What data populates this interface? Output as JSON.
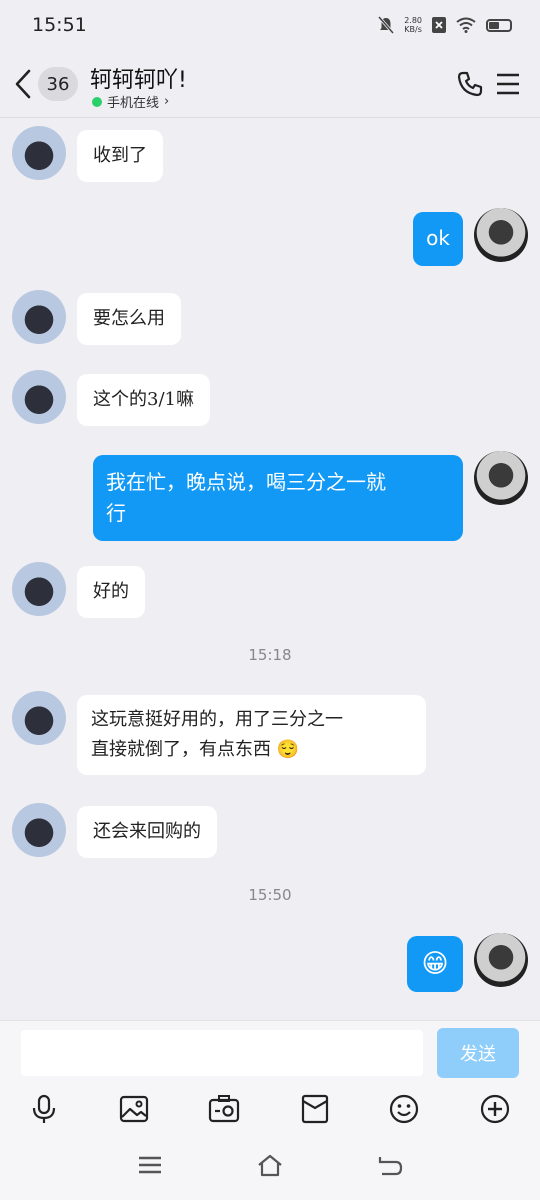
{
  "status_bar": {
    "time": "15:51",
    "net_speed_value": "2.80",
    "net_speed_unit": "KB/s"
  },
  "header": {
    "unread_count": "36",
    "contact_name": "轲轲轲吖!",
    "contact_status": "手机在线",
    "status_chevron": "›"
  },
  "messages": [
    {
      "side": "left",
      "text": "收到了"
    },
    {
      "side": "right",
      "text": "ok"
    },
    {
      "side": "left",
      "text": "要怎么用"
    },
    {
      "side": "left",
      "text": "这个的3/1嘛"
    },
    {
      "side": "right",
      "text_line1": "我在忙，晚点说，喝三分之一就",
      "text_line2": "行"
    },
    {
      "side": "left",
      "text": "好的"
    },
    {
      "side": "time",
      "text": "15:18"
    },
    {
      "side": "left",
      "text_line1": "这玩意挺好用的，用了三分之一",
      "text_line2": "直接就倒了，有点东西",
      "emoji": "😌"
    },
    {
      "side": "left",
      "text": "还会来回购的"
    },
    {
      "side": "time",
      "text": "15:50"
    },
    {
      "side": "right",
      "emoji": "😁"
    }
  ],
  "input": {
    "placeholder": "",
    "value": "",
    "send_label": "发送"
  },
  "toolbar": {
    "icons": [
      "microphone-icon",
      "image-icon",
      "camera-icon",
      "red-packet-icon",
      "emoji-icon",
      "plus-icon"
    ]
  },
  "navigation": {
    "icons": [
      "menu-icon",
      "home-icon",
      "back-icon"
    ]
  },
  "colors": {
    "accent": "#1298f5",
    "send_disabled": "#8fcdfb",
    "online": "#2ad06a",
    "background": "#eeeef3"
  }
}
